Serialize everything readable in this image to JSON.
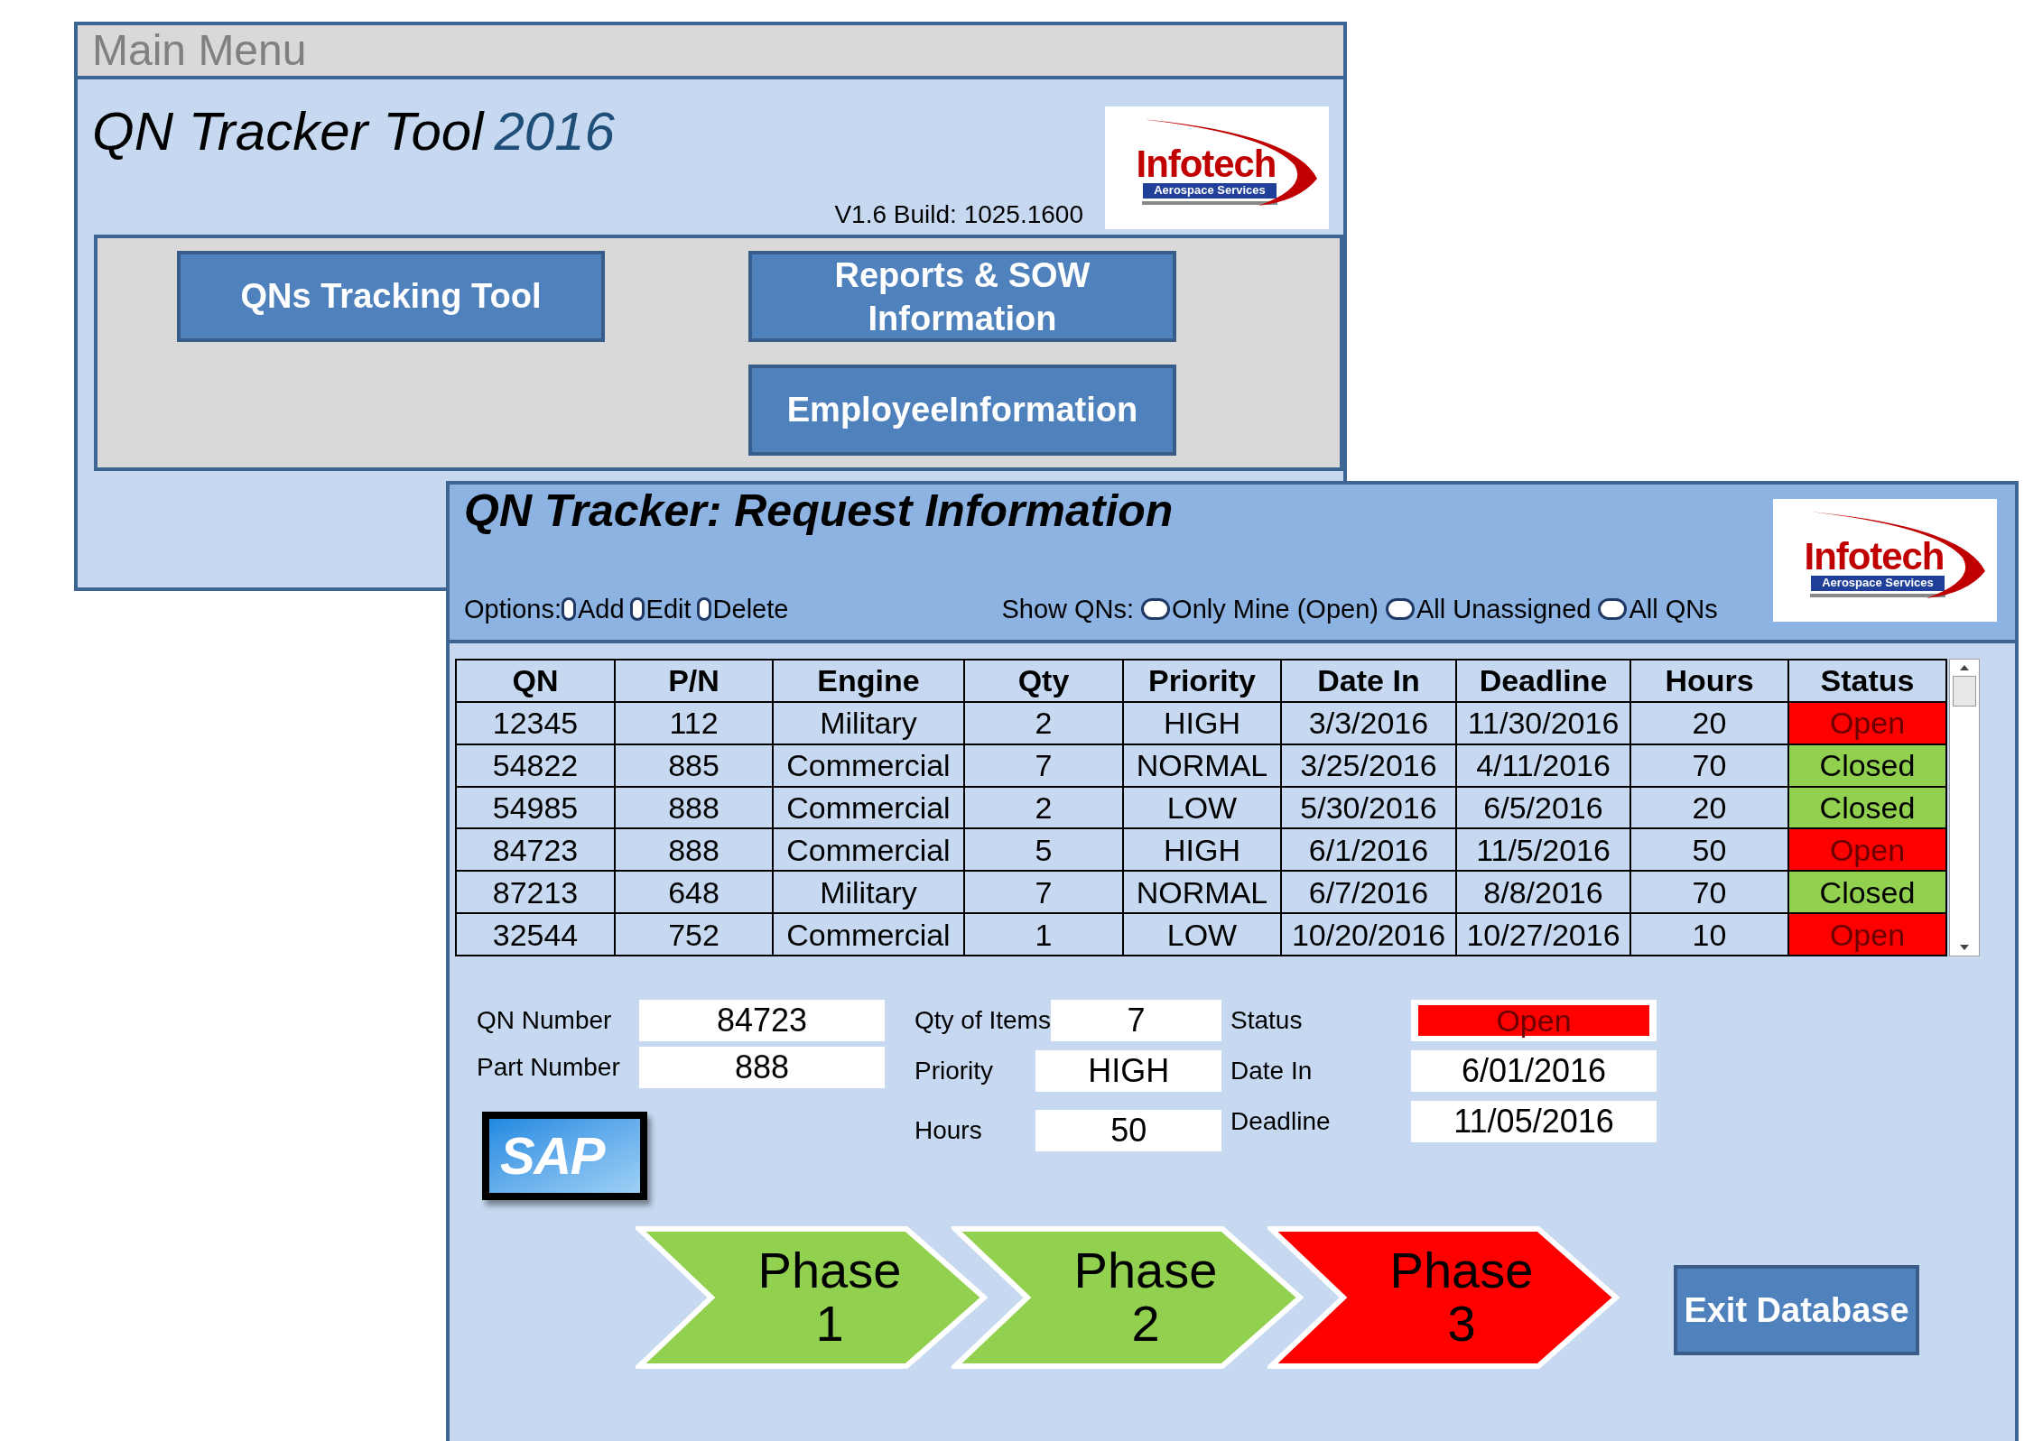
{
  "main_menu": {
    "title": "Main Menu",
    "app_title": "QN Tracker Tool",
    "app_year": "2016",
    "version": "V1.6 Build: 1025.1600",
    "logo": {
      "name": "Infotech",
      "subtitle": "Aerospace Services"
    },
    "buttons": [
      {
        "label": "QNs Tracking Tool"
      },
      {
        "label": "Reports & SOW Information"
      },
      {
        "label": "EmployeeInformation"
      }
    ]
  },
  "request_window": {
    "title": "QN Tracker: Request Information",
    "logo": {
      "name": "Infotech",
      "subtitle": "Aerospace Services"
    },
    "options_label": "Options:",
    "options": [
      {
        "label": "Add",
        "selected": false
      },
      {
        "label": "Edit",
        "selected": false
      },
      {
        "label": "Delete",
        "selected": false
      }
    ],
    "show_label": "Show QNs:",
    "show_options": [
      {
        "label": "Only Mine (Open)",
        "selected": false
      },
      {
        "label": "All Unassigned",
        "selected": false
      },
      {
        "label": "All QNs",
        "selected": false
      }
    ],
    "table": {
      "columns": [
        "QN",
        "P/N",
        "Engine",
        "Qty",
        "Priority",
        "Date In",
        "Deadline",
        "Hours",
        "Status"
      ],
      "rows": [
        {
          "cells": [
            "12345",
            "112",
            "Military",
            "2",
            "HIGH",
            "3/3/2016",
            "11/30/2016",
            "20"
          ],
          "status": "Open",
          "color": "#ff0000"
        },
        {
          "cells": [
            "54822",
            "885",
            "Commercial",
            "7",
            "NORMAL",
            "3/25/2016",
            "4/11/2016",
            "70"
          ],
          "status": "Closed",
          "color": "#92d050"
        },
        {
          "cells": [
            "54985",
            "888",
            "Commercial",
            "2",
            "LOW",
            "5/30/2016",
            "6/5/2016",
            "20"
          ],
          "status": "Closed",
          "color": "#92d050"
        },
        {
          "cells": [
            "84723",
            "888",
            "Commercial",
            "5",
            "HIGH",
            "6/1/2016",
            "11/5/2016",
            "50"
          ],
          "status": "Open",
          "color": "#ff0000"
        },
        {
          "cells": [
            "87213",
            "648",
            "Military",
            "7",
            "NORMAL",
            "6/7/2016",
            "8/8/2016",
            "70"
          ],
          "status": "Closed",
          "color": "#92d050"
        },
        {
          "cells": [
            "32544",
            "752",
            "Commercial",
            "1",
            "LOW",
            "10/20/2016",
            "10/27/2016",
            "10"
          ],
          "status": "Open",
          "color": "#ff0000"
        }
      ]
    },
    "form": [
      [
        {
          "label": "QN Number",
          "value": "84723"
        },
        {
          "label": "Part Number",
          "value": "888"
        }
      ],
      [
        {
          "label": "Qty of Items",
          "value": "7"
        },
        {
          "label": "Priority",
          "value": "HIGH"
        },
        {
          "label": "Hours",
          "value": "50"
        }
      ],
      [
        {
          "label": "Status",
          "value": "Open",
          "color": "#ff0000"
        },
        {
          "label": "Date In",
          "value": "6/01/2016"
        },
        {
          "label": "Deadline",
          "value": "11/05/2016"
        }
      ]
    ],
    "sap_logo": "SAP",
    "phases": [
      {
        "label": "Phase 1",
        "color": "#92d050"
      },
      {
        "label": "Phase 2",
        "color": "#92d050"
      },
      {
        "label": "Phase 3",
        "color": "#ff0000"
      }
    ],
    "exit_button": "Exit Database"
  }
}
